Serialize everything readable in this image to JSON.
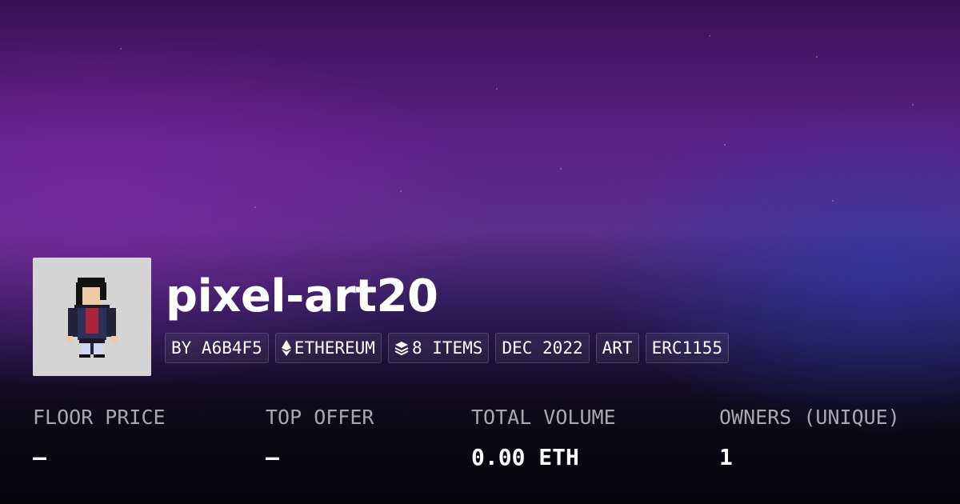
{
  "collection": {
    "name": "pixel-art20",
    "badges": [
      {
        "label": "BY A6B4F5",
        "icon": ""
      },
      {
        "label": "ETHEREUM",
        "icon": "ethereum-icon"
      },
      {
        "label": "8 ITEMS",
        "icon": "layers-icon"
      },
      {
        "label": "DEC 2022",
        "icon": ""
      },
      {
        "label": "ART",
        "icon": ""
      },
      {
        "label": "ERC1155",
        "icon": ""
      }
    ]
  },
  "stats": [
    {
      "label": "FLOOR PRICE",
      "value": "—"
    },
    {
      "label": "TOP OFFER",
      "value": "—"
    },
    {
      "label": "TOTAL VOLUME",
      "value": "0.00 ETH"
    },
    {
      "label": "OWNERS (UNIQUE)",
      "value": "1"
    }
  ],
  "colors": {
    "background_top": "#3a0f55",
    "background_mid": "#5b2186",
    "background_glow_blue": "#283caa",
    "background_bottom": "#050409",
    "avatar_bg": "#d4d4d4",
    "label_gray": "#a8a8b2",
    "text_white": "#ffffff"
  }
}
